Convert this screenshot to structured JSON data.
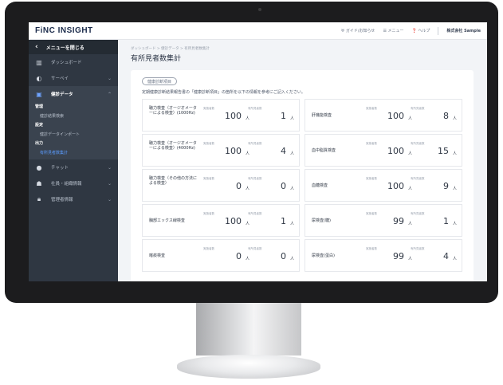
{
  "header": {
    "logo": "FiNC INSIGHT",
    "links": [
      "ガイド/お知らせ",
      "メニュー",
      "ヘルプ"
    ],
    "company": "株式会社 Sample"
  },
  "sidebar": {
    "close_label": "メニューを閉じる",
    "items": [
      {
        "label": "ダッシュボード",
        "icon": "bar-chart-icon"
      },
      {
        "label": "サーベイ",
        "icon": "survey-icon"
      },
      {
        "label": "健診データ",
        "icon": "clipboard-icon"
      },
      {
        "label": "チャット",
        "icon": "chat-icon"
      },
      {
        "label": "社員・組織情報",
        "icon": "person-icon"
      },
      {
        "label": "管理者情報",
        "icon": "lock-icon"
      }
    ],
    "sub": {
      "kanri": "管理",
      "kanri_item": "健診結果検索",
      "settei": "設定",
      "settei_item": "健診データインポート",
      "shutsuryoku": "出力",
      "shutsuryoku_item": "有所見者数集計"
    }
  },
  "main": {
    "breadcrumb": "ダッシュボード > 健診データ > 有所見者数集計",
    "title": "有所見者数集計",
    "tag": "健康診断項目",
    "note": "定期健康診断結果報告書の「健康診断項目」の箇所を以下の情報を参考にご記入ください。",
    "label_implemented": "実施者数",
    "label_findings": "有所見者数",
    "unit": "人",
    "items": [
      {
        "name": "聴力検査（オージオメーターによる検査）(1000Hz)",
        "implemented": "100",
        "findings": "1"
      },
      {
        "name": "肝機能検査",
        "implemented": "100",
        "findings": "8"
      },
      {
        "name": "聴力検査（オージオメーターによる検査）(4000Hz)",
        "implemented": "100",
        "findings": "4"
      },
      {
        "name": "血中脂質検査",
        "implemented": "100",
        "findings": "15"
      },
      {
        "name": "聴力検査（その他の方法による検査）",
        "implemented": "0",
        "findings": "0"
      },
      {
        "name": "血糖検査",
        "implemented": "100",
        "findings": "9"
      },
      {
        "name": "胸部エックス線検査",
        "implemented": "100",
        "findings": "1"
      },
      {
        "name": "尿検査(糖)",
        "implemented": "99",
        "findings": "1"
      },
      {
        "name": "喀痰検査",
        "implemented": "0",
        "findings": "0"
      },
      {
        "name": "尿検査(蛋白)",
        "implemented": "99",
        "findings": "4"
      }
    ]
  }
}
